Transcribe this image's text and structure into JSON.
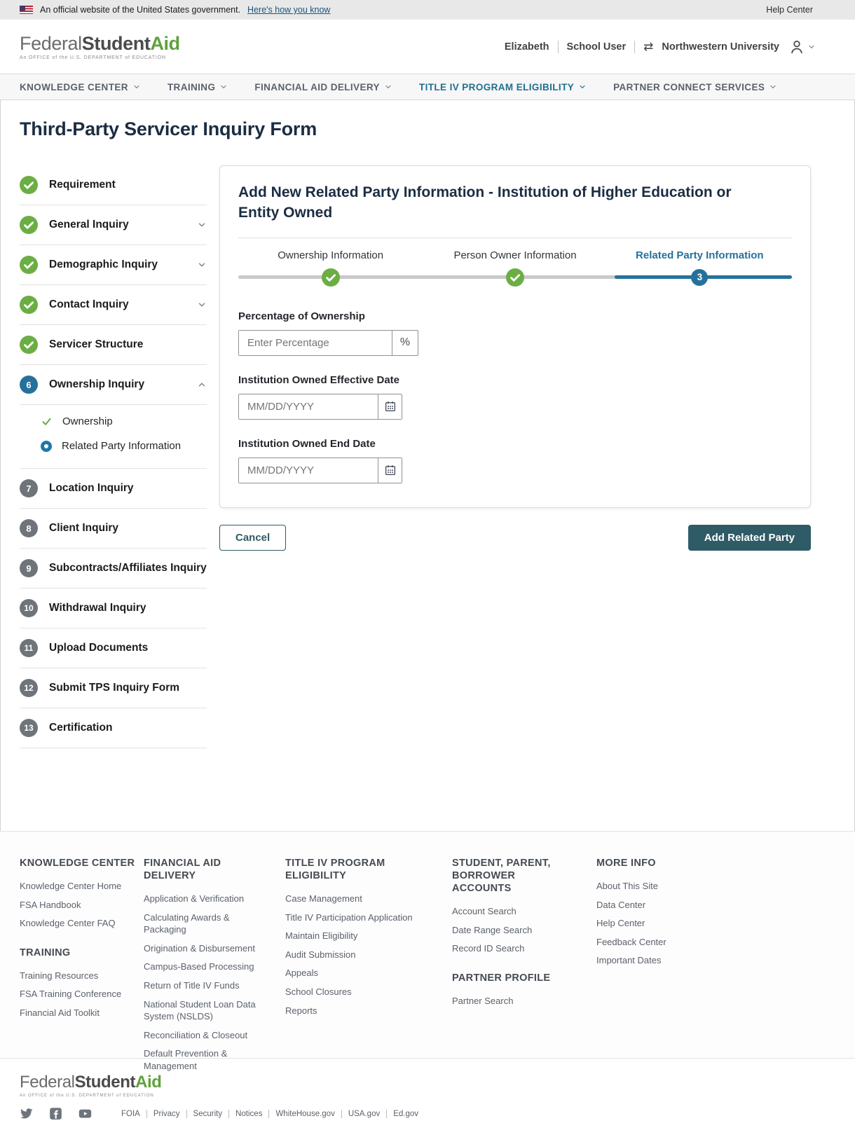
{
  "colors": {
    "green": "#6bae44",
    "accent_blue": "#26719b",
    "button_teal": "#2e5b66",
    "nav_active": "#1f6e91",
    "heading_navy": "#1b2d42"
  },
  "banner": {
    "text": "An official website of the United States government.",
    "link": "Here's how you know",
    "help_center": "Help Center"
  },
  "header": {
    "logo": {
      "federal": "Federal",
      "student": "Student",
      "aid": "Aid",
      "tagline": "An OFFICE of the U.S. DEPARTMENT of EDUCATION"
    },
    "user": {
      "name": "Elizabeth",
      "role": "School User",
      "org": "Northwestern University"
    }
  },
  "nav": {
    "items": [
      {
        "label": "KNOWLEDGE CENTER",
        "active": false
      },
      {
        "label": "TRAINING",
        "active": false
      },
      {
        "label": "FINANCIAL AID DELIVERY",
        "active": false
      },
      {
        "label": "TITLE IV PROGRAM ELIGIBILITY",
        "active": true
      },
      {
        "label": "PARTNER CONNECT SERVICES",
        "active": false
      }
    ]
  },
  "page": {
    "title": "Third-Party Servicer Inquiry Form"
  },
  "sidebar": {
    "items": [
      {
        "label": "Requirement",
        "status": "complete"
      },
      {
        "label": "General Inquiry",
        "status": "complete",
        "chevron": "down"
      },
      {
        "label": "Demographic Inquiry",
        "status": "complete",
        "chevron": "down"
      },
      {
        "label": "Contact Inquiry",
        "status": "complete",
        "chevron": "down"
      },
      {
        "label": "Servicer Structure",
        "status": "complete"
      },
      {
        "label": "Ownership Inquiry",
        "status": "active",
        "number": "6",
        "chevron": "up",
        "children": [
          {
            "label": "Ownership",
            "status": "complete"
          },
          {
            "label": "Related Party Information",
            "status": "active"
          }
        ]
      },
      {
        "label": "Location Inquiry",
        "status": "pending",
        "number": "7"
      },
      {
        "label": "Client Inquiry",
        "status": "pending",
        "number": "8"
      },
      {
        "label": "Subcontracts/Affiliates Inquiry",
        "status": "pending",
        "number": "9"
      },
      {
        "label": "Withdrawal Inquiry",
        "status": "pending",
        "number": "10"
      },
      {
        "label": "Upload Documents",
        "status": "pending",
        "number": "11"
      },
      {
        "label": "Submit TPS Inquiry Form",
        "status": "pending",
        "number": "12"
      },
      {
        "label": "Certification",
        "status": "pending",
        "number": "13"
      }
    ]
  },
  "main": {
    "title": "Add New Related Party Information - Institution of Higher Education or Entity Owned",
    "stepper": [
      {
        "label": "Ownership Information",
        "status": "complete"
      },
      {
        "label": "Person Owner Information",
        "status": "complete"
      },
      {
        "label": "Related Party Information",
        "status": "active",
        "number": "3"
      }
    ],
    "fields": {
      "percentage": {
        "label": "Percentage of Ownership",
        "placeholder": "Enter Percentage",
        "suffix": "%"
      },
      "effective_date": {
        "label": "Institution Owned Effective Date",
        "placeholder": "MM/DD/YYYY"
      },
      "end_date": {
        "label": "Institution Owned End Date",
        "placeholder": "MM/DD/YYYY"
      }
    },
    "buttons": {
      "cancel": "Cancel",
      "submit": "Add Related Party"
    }
  },
  "footer": {
    "columns": [
      {
        "sections": [
          {
            "heading": "KNOWLEDGE CENTER",
            "links": [
              "Knowledge Center Home",
              "FSA Handbook",
              "Knowledge Center FAQ"
            ]
          },
          {
            "heading": "TRAINING",
            "links": [
              "Training Resources",
              "FSA Training Conference",
              "Financial Aid Toolkit"
            ]
          }
        ]
      },
      {
        "sections": [
          {
            "heading": "FINANCIAL AID DELIVERY",
            "links": [
              "Application & Verification",
              "Calculating Awards & Packaging",
              "Origination & Disbursement",
              "Campus-Based Processing",
              "Return of Title IV Funds",
              "National Student Loan Data System (NSLDS)",
              "Reconciliation & Closeout",
              "Default Prevention & Management"
            ]
          }
        ]
      },
      {
        "sections": [
          {
            "heading": "TITLE IV PROGRAM ELIGIBILITY",
            "links": [
              "Case Management",
              "Title IV Participation Application",
              "Maintain Eligibility",
              "Audit Submission",
              "Appeals",
              "School Closures",
              "Reports"
            ]
          }
        ]
      },
      {
        "sections": [
          {
            "heading": "STUDENT, PARENT, BORROWER ACCOUNTS",
            "links": [
              "Account Search",
              "Date Range Search",
              "Record ID Search"
            ]
          },
          {
            "heading": "PARTNER PROFILE",
            "links": [
              "Partner Search"
            ]
          }
        ]
      },
      {
        "sections": [
          {
            "heading": "MORE INFO",
            "links": [
              "About This Site",
              "Data Center",
              "Help Center",
              "Feedback Center",
              "Important Dates"
            ]
          }
        ]
      }
    ]
  },
  "bottom": {
    "links": [
      "FOIA",
      "Privacy",
      "Security",
      "Notices",
      "WhiteHouse.gov",
      "USA.gov",
      "Ed.gov"
    ],
    "social": [
      "twitter",
      "facebook",
      "youtube"
    ]
  }
}
